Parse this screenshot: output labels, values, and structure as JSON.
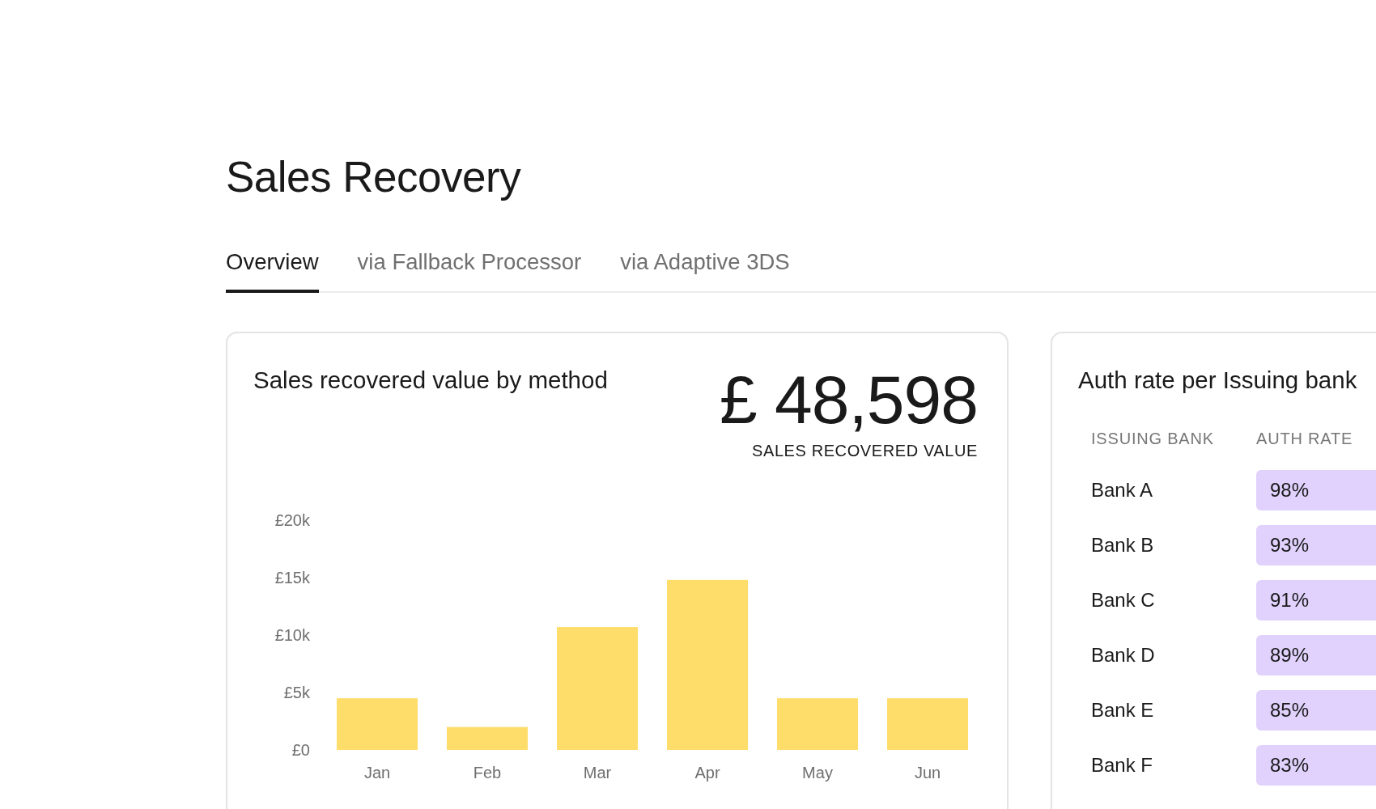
{
  "page": {
    "title": "Sales Recovery"
  },
  "tabs": [
    {
      "label": "Overview",
      "selected": true
    },
    {
      "label": "via Fallback Processor",
      "selected": false
    },
    {
      "label": "via Adaptive 3DS",
      "selected": false
    }
  ],
  "sales_card": {
    "title": "Sales recovered value by method",
    "total": "£ 48,598",
    "total_label": "SALES RECOVERED VALUE",
    "chart_data": {
      "type": "bar",
      "categories": [
        "Jan",
        "Feb",
        "Mar",
        "Apr",
        "May",
        "Jun"
      ],
      "series": [
        {
          "color": "#fedd6b",
          "values": [
            4500,
            2000,
            10700,
            14800,
            4500,
            4500
          ]
        }
      ],
      "ylim": [
        0,
        20000
      ],
      "yticks": [
        {
          "value": 0,
          "label": "£0"
        },
        {
          "value": 5000,
          "label": "£5k"
        },
        {
          "value": 10000,
          "label": "£10k"
        },
        {
          "value": 15000,
          "label": "£15k"
        },
        {
          "value": 20000,
          "label": "£20k"
        }
      ]
    }
  },
  "auth_card": {
    "title": "Auth rate per Issuing bank",
    "columns": [
      "ISSUING BANK",
      "AUTH RATE"
    ],
    "rows": [
      {
        "bank": "Bank A",
        "rate": "98%"
      },
      {
        "bank": "Bank B",
        "rate": "93%"
      },
      {
        "bank": "Bank C",
        "rate": "91%"
      },
      {
        "bank": "Bank D",
        "rate": "89%"
      },
      {
        "bank": "Bank E",
        "rate": "85%"
      },
      {
        "bank": "Bank F",
        "rate": "83%"
      }
    ]
  }
}
